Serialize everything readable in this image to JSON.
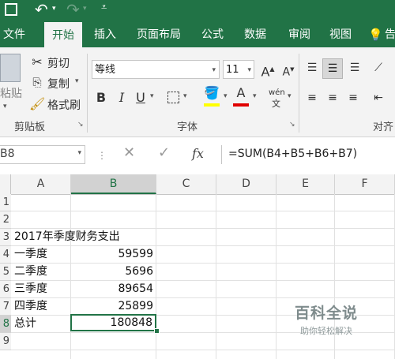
{
  "ribbon_tabs": [
    "文件",
    "开始",
    "插入",
    "页面布局",
    "公式",
    "数据",
    "审阅",
    "视图",
    "告"
  ],
  "active_tab": "开始",
  "clipboard": {
    "paste_label": "粘贴",
    "cut_label": "剪切",
    "copy_label": "复制",
    "format_painter_label": "格式刷",
    "group_label": "剪贴板"
  },
  "font": {
    "font_name": "等线",
    "font_size": "11",
    "bold": "B",
    "italic": "I",
    "underline": "U",
    "phonetic": "wén",
    "group_label": "字体"
  },
  "alignment": {
    "group_label": "对齐"
  },
  "formula_bar": {
    "name_box": "B8",
    "fx": "fx",
    "formula": "=SUM(B4+B5+B6+B7)"
  },
  "columns": [
    "A",
    "B",
    "C",
    "D",
    "E",
    "F"
  ],
  "rows": [
    "1",
    "2",
    "3",
    "4",
    "5",
    "6",
    "7",
    "8",
    "9"
  ],
  "cells": {
    "title": "2017年季度财务支出",
    "q1_label": "一季度",
    "q1_value": "59599",
    "q2_label": "二季度",
    "q2_value": "5696",
    "q3_label": "三季度",
    "q3_value": "89654",
    "q4_label": "四季度",
    "q4_value": "25899",
    "total_label": "总计",
    "total_value": "180848"
  },
  "watermark": {
    "brand": "百科全说",
    "tagline": "助你轻松解决"
  },
  "colors": {
    "excel_green": "#217346",
    "selection": "#217346",
    "ribbon_bg": "#f3f3f3",
    "font_color_red": "#e00000",
    "highlight_yellow": "#ffff00"
  }
}
